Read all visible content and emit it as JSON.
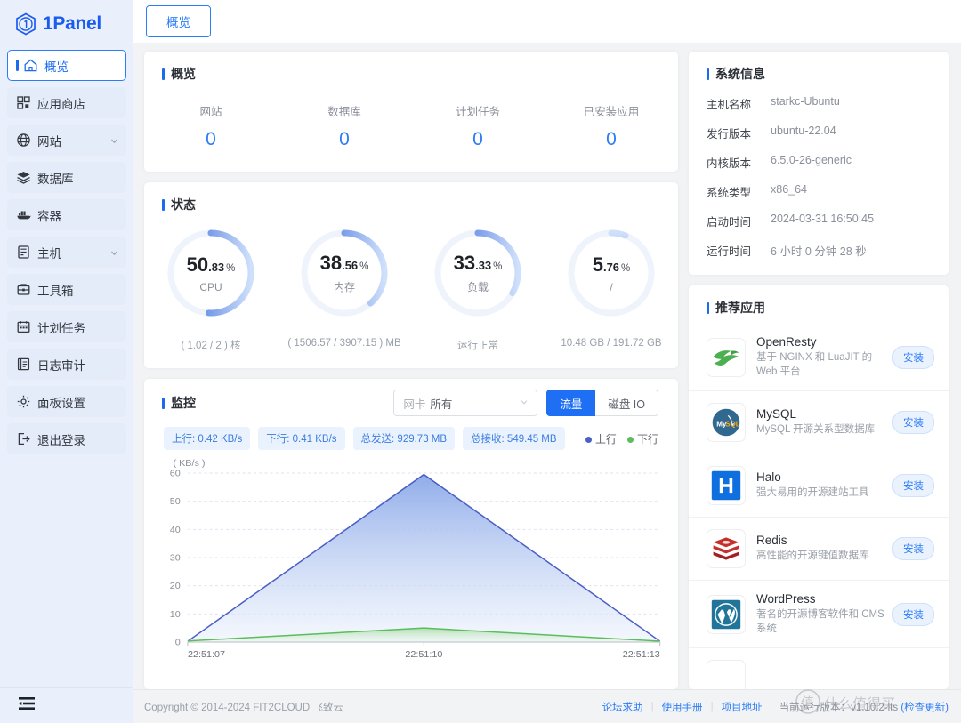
{
  "brand": {
    "name": "1Panel",
    "logo_icon": "hexagon-one-logo"
  },
  "sidebar": {
    "items": [
      {
        "label": "概览",
        "icon": "home-icon",
        "active": true,
        "expandable": false
      },
      {
        "label": "应用商店",
        "icon": "apps-grid-icon",
        "active": false,
        "expandable": false
      },
      {
        "label": "网站",
        "icon": "globe-icon",
        "active": false,
        "expandable": true
      },
      {
        "label": "数据库",
        "icon": "database-stack-icon",
        "active": false,
        "expandable": false
      },
      {
        "label": "容器",
        "icon": "docker-whale-icon",
        "active": false,
        "expandable": false
      },
      {
        "label": "主机",
        "icon": "server-icon",
        "active": false,
        "expandable": true
      },
      {
        "label": "工具箱",
        "icon": "toolbox-icon",
        "active": false,
        "expandable": false
      },
      {
        "label": "计划任务",
        "icon": "calendar-icon",
        "active": false,
        "expandable": false
      },
      {
        "label": "日志审计",
        "icon": "document-list-icon",
        "active": false,
        "expandable": false
      },
      {
        "label": "面板设置",
        "icon": "gear-icon",
        "active": false,
        "expandable": false
      },
      {
        "label": "退出登录",
        "icon": "logout-icon",
        "active": false,
        "expandable": false
      }
    ],
    "collapse_icon": "menu-collapse-icon"
  },
  "topbar": {
    "tab_label": "概览"
  },
  "overview": {
    "title": "概览",
    "stats": [
      {
        "label": "网站",
        "value": "0"
      },
      {
        "label": "数据库",
        "value": "0"
      },
      {
        "label": "计划任务",
        "value": "0"
      },
      {
        "label": "已安装应用",
        "value": "0"
      }
    ]
  },
  "status": {
    "title": "状态",
    "gauges": [
      {
        "int": "50",
        "dec": ".83",
        "unit": "%",
        "name": "CPU",
        "sub": "( 1.02 / 2 ) 核",
        "percent": 50.83
      },
      {
        "int": "38",
        "dec": ".56",
        "unit": "%",
        "name": "内存",
        "sub": "( 1506.57 / 3907.15 ) MB",
        "percent": 38.56
      },
      {
        "int": "33",
        "dec": ".33",
        "unit": "%",
        "name": "负载",
        "sub": "运行正常",
        "percent": 33.33
      },
      {
        "int": "5",
        "dec": ".76",
        "unit": "%",
        "name": "/",
        "sub": "10.48 GB / 191.72 GB",
        "percent": 5.76
      }
    ]
  },
  "monitor": {
    "title": "监控",
    "select": {
      "prefix": "网卡",
      "value": "所有",
      "chevron_icon": "chevron-down-icon"
    },
    "segments": [
      {
        "label": "流量",
        "active": true
      },
      {
        "label": "磁盘 IO",
        "active": false
      }
    ],
    "badges": [
      "上行: 0.42 KB/s",
      "下行: 0.41 KB/s",
      "总发送: 929.73 MB",
      "总接收: 549.45 MB"
    ],
    "legend": [
      {
        "label": "上行",
        "color": "#4b5fc4"
      },
      {
        "label": "下行",
        "color": "#5bbd5b"
      }
    ],
    "chart_data": {
      "type": "area",
      "title": "",
      "unit_label": "( KB/s )",
      "xlabel": "",
      "ylabel": "KB/s",
      "x": [
        "22:51:07",
        "22:51:10",
        "22:51:13"
      ],
      "xtick_labels": [
        "22:51:07",
        "22:51:10",
        "22:51:13"
      ],
      "ytick_labels": [
        "0",
        "10",
        "20",
        "30",
        "40",
        "50",
        "60"
      ],
      "ylim": [
        0,
        60
      ],
      "grid": true,
      "legend_position": "top-right",
      "series": [
        {
          "name": "上行",
          "color": "#4b5fc4",
          "values": [
            0.3,
            59.5,
            0.3
          ]
        },
        {
          "name": "下行",
          "color": "#5bbd5b",
          "values": [
            0.4,
            5.0,
            0.3
          ]
        }
      ]
    }
  },
  "system_info": {
    "title": "系统信息",
    "rows": [
      {
        "key": "主机名称",
        "value": "starkc-Ubuntu"
      },
      {
        "key": "发行版本",
        "value": "ubuntu-22.04"
      },
      {
        "key": "内核版本",
        "value": "6.5.0-26-generic"
      },
      {
        "key": "系统类型",
        "value": "x86_64"
      },
      {
        "key": "启动时间",
        "value": "2024-03-31 16:50:45"
      },
      {
        "key": "运行时间",
        "value": "6 小时 0 分钟 28 秒"
      }
    ]
  },
  "recommended": {
    "title": "推荐应用",
    "install_label": "安装",
    "apps": [
      {
        "name": "OpenResty",
        "desc": "基于 NGINX 和 LuaJIT 的 Web 平台",
        "icon": "openresty-icon"
      },
      {
        "name": "MySQL",
        "desc": "MySQL 开源关系型数据库",
        "icon": "mysql-icon"
      },
      {
        "name": "Halo",
        "desc": "强大易用的开源建站工具",
        "icon": "halo-icon"
      },
      {
        "name": "Redis",
        "desc": "高性能的开源键值数据库",
        "icon": "redis-icon"
      },
      {
        "name": "WordPress",
        "desc": "著名的开源博客软件和 CMS 系统",
        "icon": "wordpress-icon"
      }
    ]
  },
  "footer": {
    "copyright": "Copyright © 2014-2024 FIT2CLOUD 飞致云",
    "links": [
      "论坛求助",
      "使用手册",
      "项目地址"
    ],
    "version_label": "当前运行版本：",
    "version": "v1.10.2-lts",
    "check_update": "(检查更新)"
  },
  "colors": {
    "accent": "#2a7cf7",
    "gauge_dark": "#2b5fd9",
    "gauge_light": "#cfe0fb"
  }
}
